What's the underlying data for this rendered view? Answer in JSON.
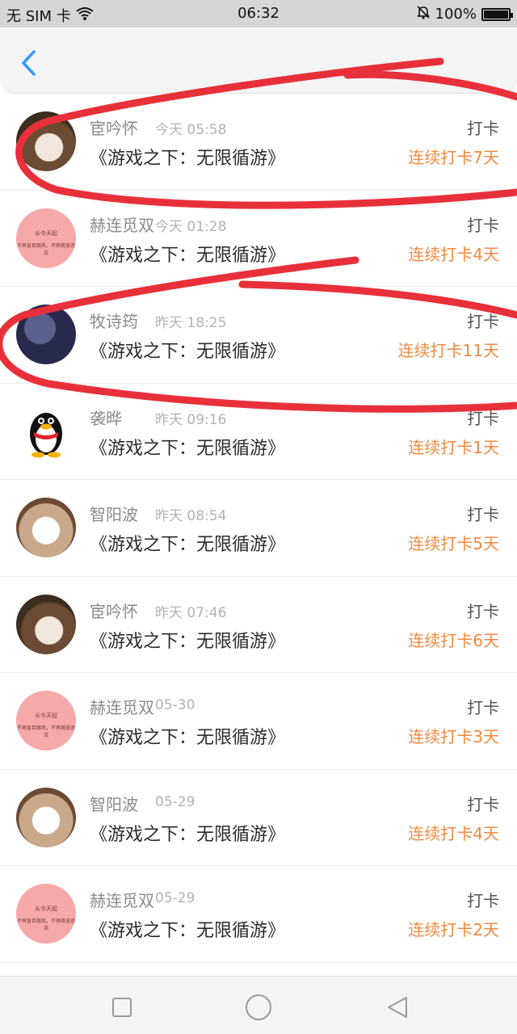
{
  "status_bar": {
    "carrier": "无 SIM 卡",
    "time": "06:32",
    "battery": "100%",
    "battery_level": 1.0,
    "icons": [
      "wifi-icon",
      "mute-bell-icon",
      "battery-icon"
    ]
  },
  "header": {
    "back_icon": "chevron-left-icon"
  },
  "list": [
    {
      "name": "宦吟怀",
      "time": "今天 05:58",
      "title": "《游戏之下：无限循游》",
      "action": "打卡",
      "streak": "连续打卡7天",
      "avatar": "photo"
    },
    {
      "name": "赫连觅双",
      "time": "今天 01:28",
      "title": "《游戏之下：无限循游》",
      "action": "打卡",
      "streak": "连续打卡4天",
      "avatar": "pink"
    },
    {
      "name": "牧诗筠",
      "time": "昨天 18:25",
      "title": "《游戏之下：无限循游》",
      "action": "打卡",
      "streak": "连续打卡11天",
      "avatar": "dark"
    },
    {
      "name": "袭晔",
      "time": "昨天 09:16",
      "title": "《游戏之下：无限循游》",
      "action": "打卡",
      "streak": "连续打卡1天",
      "avatar": "qq"
    },
    {
      "name": "智阳波",
      "time": "昨天 08:54",
      "title": "《游戏之下：无限循游》",
      "action": "打卡",
      "streak": "连续打卡5天",
      "avatar": "photo2"
    },
    {
      "name": "宦吟怀",
      "time": "昨天 07:46",
      "title": "《游戏之下：无限循游》",
      "action": "打卡",
      "streak": "连续打卡6天",
      "avatar": "photo"
    },
    {
      "name": "赫连觅双",
      "time": "05-30",
      "title": "《游戏之下：无限循游》",
      "action": "打卡",
      "streak": "连续打卡3天",
      "avatar": "pink"
    },
    {
      "name": "智阳波",
      "time": "05-29",
      "title": "《游戏之下：无限循游》",
      "action": "打卡",
      "streak": "连续打卡4天",
      "avatar": "photo2"
    },
    {
      "name": "赫连觅双",
      "time": "05-29",
      "title": "《游戏之下：无限循游》",
      "action": "打卡",
      "streak": "连续打卡2天",
      "avatar": "pink"
    }
  ],
  "pink_avatar": {
    "line1": "从今天起",
    "line2": "不再盲目跟风，不再随波逐流"
  },
  "nav_bar": {
    "icons": [
      "square-icon",
      "circle-icon",
      "triangle-back-icon"
    ]
  },
  "colors": {
    "accent": "#f08a40",
    "annotation": "#e8303a"
  }
}
